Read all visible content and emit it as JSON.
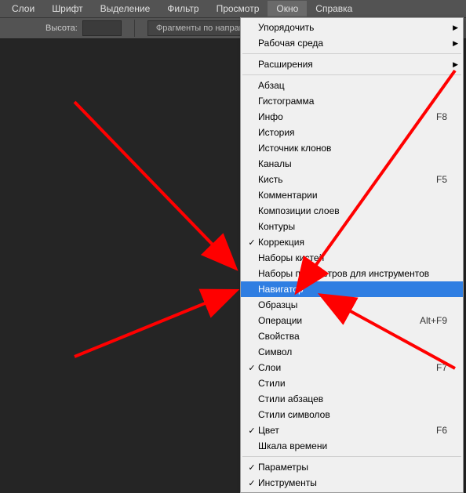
{
  "menubar": {
    "items": [
      {
        "label": "Слои"
      },
      {
        "label": "Шрифт"
      },
      {
        "label": "Выделение"
      },
      {
        "label": "Фильтр"
      },
      {
        "label": "Просмотр"
      },
      {
        "label": "Окно"
      },
      {
        "label": "Справка"
      }
    ],
    "active_index": 5
  },
  "toolbar": {
    "height_label": "Высота:",
    "height_value": "",
    "fragments_label": "Фрагменты по направляю..."
  },
  "dropdown": {
    "groups": [
      [
        {
          "label": "Упорядочить",
          "submenu": true
        },
        {
          "label": "Рабочая среда",
          "submenu": true
        }
      ],
      [
        {
          "label": "Расширения",
          "submenu": true
        }
      ],
      [
        {
          "label": "Абзац"
        },
        {
          "label": "Гистограмма"
        },
        {
          "label": "Инфо",
          "shortcut": "F8"
        },
        {
          "label": "История"
        },
        {
          "label": "Источник клонов"
        },
        {
          "label": "Каналы"
        },
        {
          "label": "Кисть",
          "shortcut": "F5"
        },
        {
          "label": "Комментарии"
        },
        {
          "label": "Композиции слоев"
        },
        {
          "label": "Контуры"
        },
        {
          "label": "Коррекция",
          "checked": true
        },
        {
          "label": "Наборы кистей"
        },
        {
          "label": "Наборы параметров для инструментов"
        },
        {
          "label": "Навигатор",
          "highlighted": true
        },
        {
          "label": "Образцы"
        },
        {
          "label": "Операции",
          "shortcut": "Alt+F9"
        },
        {
          "label": "Свойства"
        },
        {
          "label": "Символ"
        },
        {
          "label": "Слои",
          "shortcut": "F7",
          "checked": true
        },
        {
          "label": "Стили"
        },
        {
          "label": "Стили абзацев"
        },
        {
          "label": "Стили символов"
        },
        {
          "label": "Цвет",
          "shortcut": "F6",
          "checked": true
        },
        {
          "label": "Шкала времени"
        }
      ],
      [
        {
          "label": "Параметры",
          "checked": true
        },
        {
          "label": "Инструменты",
          "checked": true
        }
      ]
    ]
  },
  "annotation": {
    "color": "#ff0000"
  }
}
